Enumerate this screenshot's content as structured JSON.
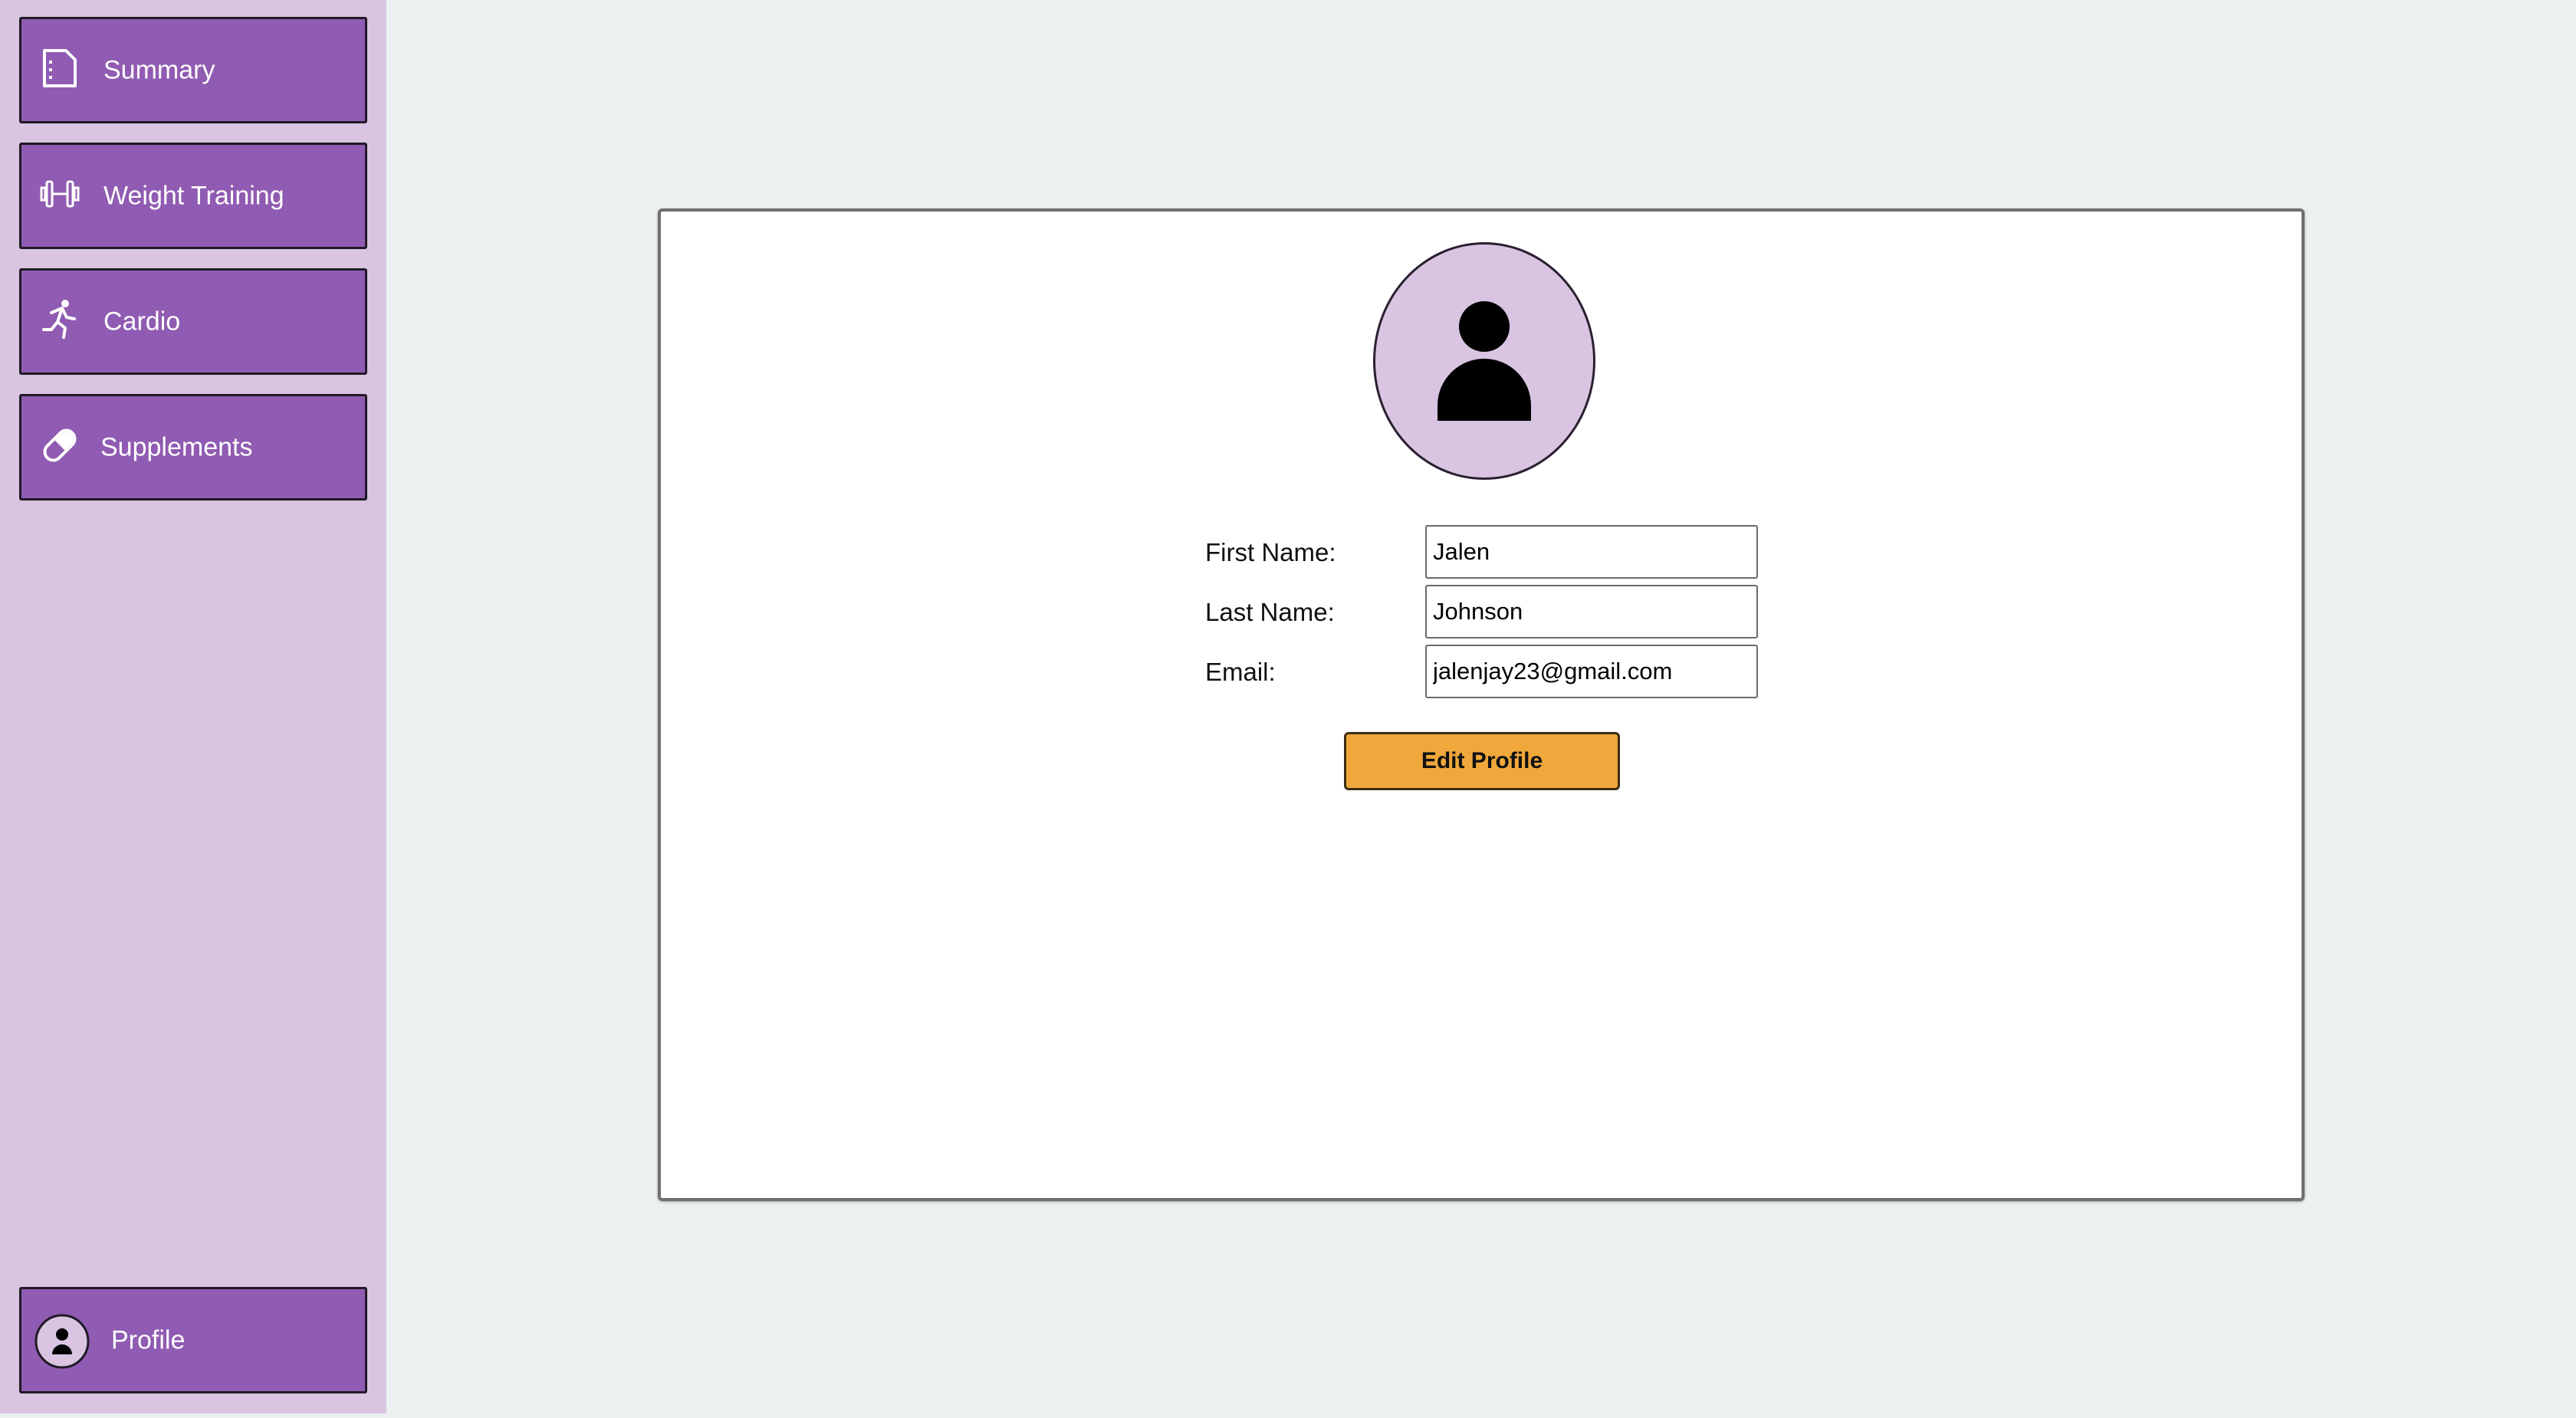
{
  "sidebar": {
    "items": [
      {
        "label": "Summary",
        "icon": "document-icon"
      },
      {
        "label": "Weight Training",
        "icon": "dumbbell-icon"
      },
      {
        "label": "Cardio",
        "icon": "running-icon"
      },
      {
        "label": "Supplements",
        "icon": "pill-icon"
      }
    ],
    "profile": {
      "label": "Profile",
      "icon": "user-avatar-icon"
    }
  },
  "profile_form": {
    "first_name_label": "First Name:",
    "first_name_value": "Jalen",
    "last_name_label": "Last Name:",
    "last_name_value": "Johnson",
    "email_label": "Email:",
    "email_value": "jalenjay23@gmail.com",
    "edit_button_label": "Edit Profile"
  },
  "colors": {
    "sidebar_bg": "#d9c4e2",
    "nav_item_bg": "#905bb2",
    "page_bg": "#ecf0f1",
    "button_bg": "#f0a73b"
  }
}
